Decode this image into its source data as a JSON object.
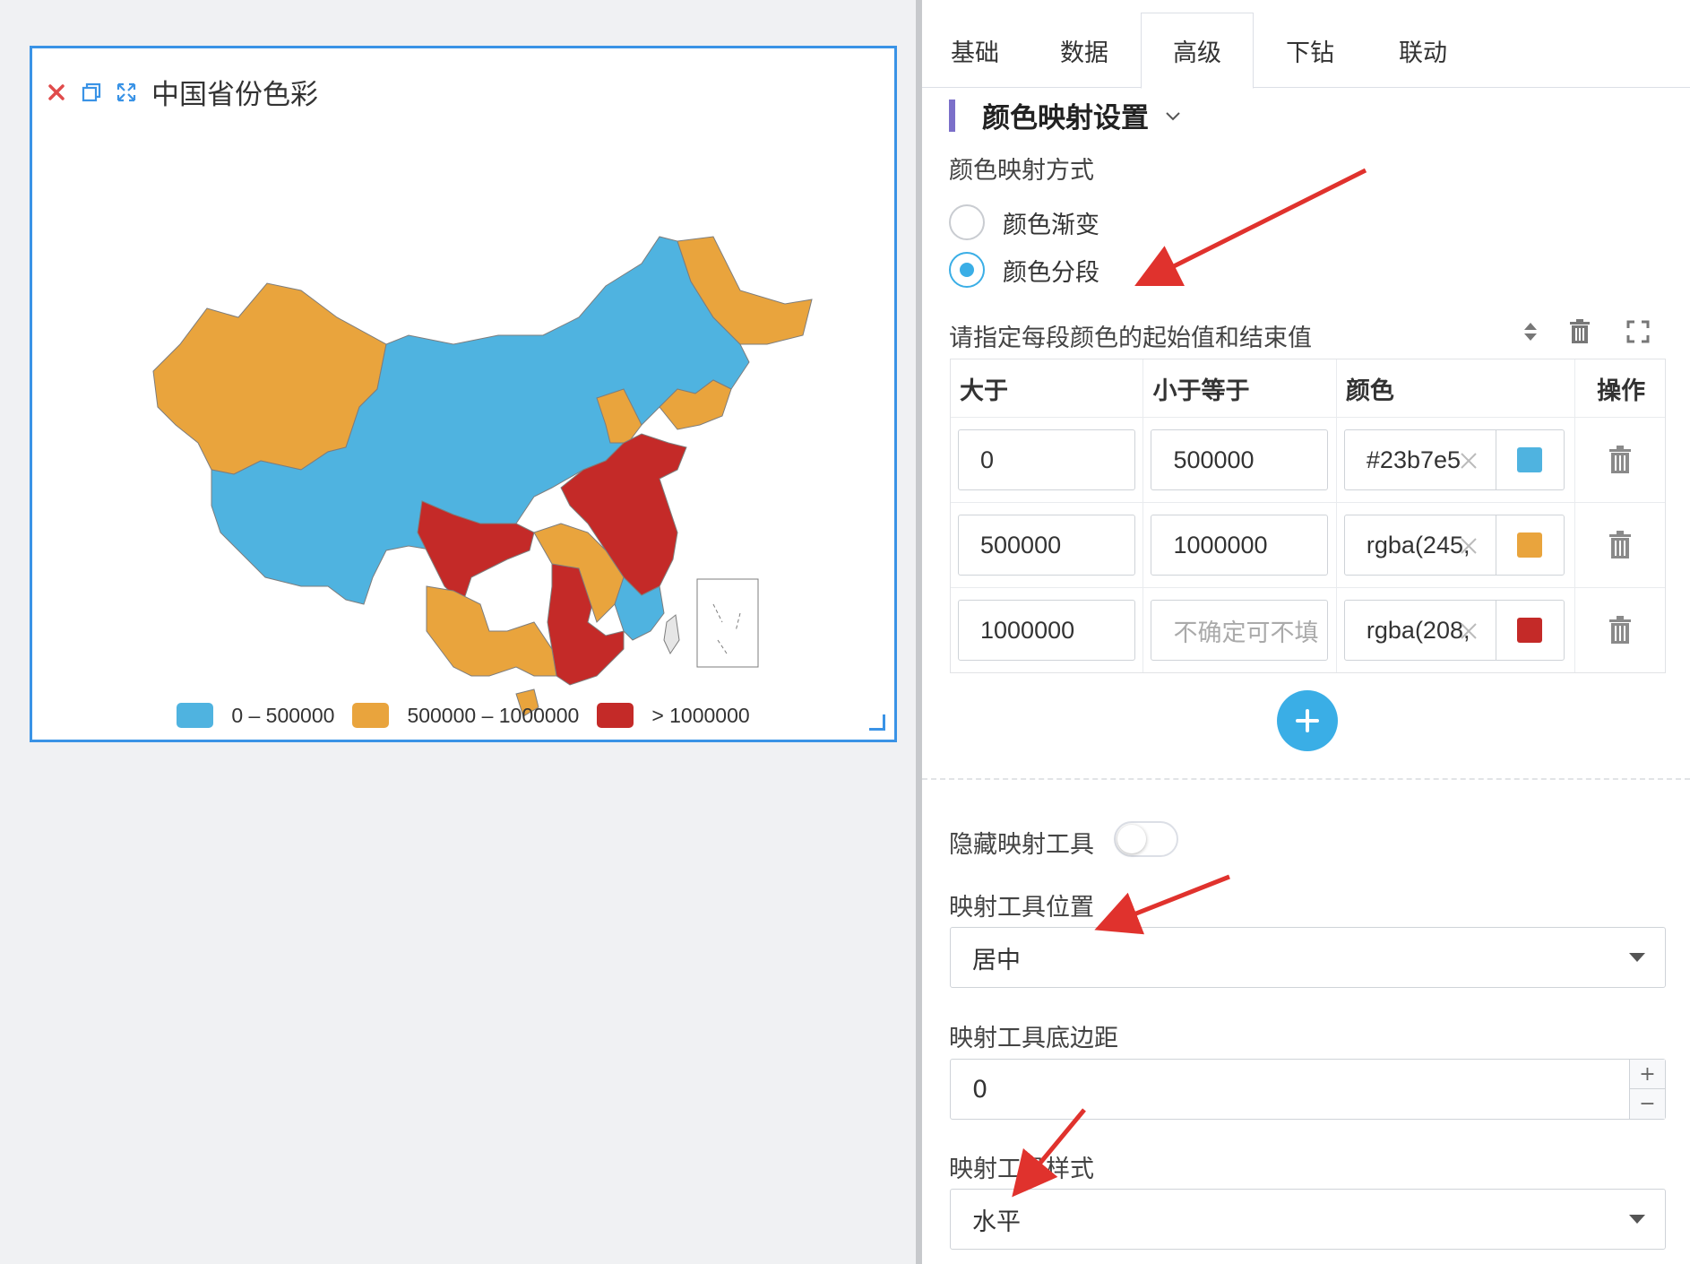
{
  "widget": {
    "title": "中国省份色彩",
    "icons": [
      "close-icon",
      "copy-icon",
      "expand-icon"
    ],
    "legend": [
      {
        "label": "0 – 500000",
        "color": "#4fb3e0"
      },
      {
        "label": "500000 – 1000000",
        "color": "#e9a43d"
      },
      {
        "label": "> 1000000",
        "color": "#c42a28"
      }
    ]
  },
  "tabs": [
    "基础",
    "数据",
    "高级",
    "下钻",
    "联动"
  ],
  "active_tab": "高级",
  "section": {
    "title": "颜色映射设置",
    "mapping_mode_label": "颜色映射方式",
    "option_gradient": "颜色渐变",
    "option_segment": "颜色分段",
    "selected_option": "颜色分段",
    "segments_hint": "请指定每段颜色的起始值和结束值"
  },
  "table": {
    "headers": [
      "大于",
      "小于等于",
      "颜色",
      "操作"
    ],
    "rows": [
      {
        "gt": "0",
        "lte": "500000",
        "lte_placeholder": "",
        "color_text": "#23b7e5",
        "swatch": "#4fb3e0"
      },
      {
        "gt": "500000",
        "lte": "1000000",
        "lte_placeholder": "",
        "color_text": "rgba(245,",
        "swatch": "#e9a43d"
      },
      {
        "gt": "1000000",
        "lte": "",
        "lte_placeholder": "不确定可不填",
        "color_text": "rgba(208,",
        "swatch": "#c42a28"
      }
    ]
  },
  "settings": {
    "hide_tool_label": "隐藏映射工具",
    "hide_tool_on": false,
    "position_label": "映射工具位置",
    "position_value": "居中",
    "bottom_margin_label": "映射工具底边距",
    "bottom_margin_value": "0",
    "style_label": "映射工具样式",
    "style_value": "水平"
  },
  "colors": {
    "accent": "#3aaee6",
    "selection_border": "#3a93e6",
    "section_bar": "#7b6fc9",
    "annotation_arrow": "#e0322d"
  }
}
